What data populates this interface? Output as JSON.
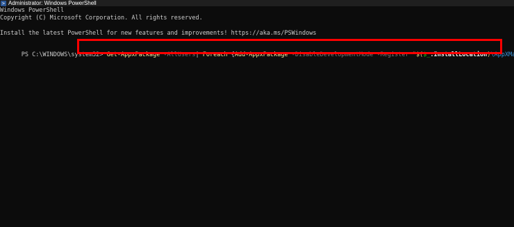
{
  "window": {
    "title": "Administrator: Windows PowerShell",
    "icon": "powershell-icon"
  },
  "console": {
    "header_line_1": "Windows PowerShell",
    "header_line_2": "Copyright (C) Microsoft Corporation. All rights reserved.",
    "header_line_3": "Install the latest PowerShell for new features and improvements! https://aka.ms/PSWindows",
    "prompt": "PS C:\\WINDOWS\\system32> ",
    "command_tokens": [
      {
        "text": "Get-AppxPackage",
        "role": "cmdlet"
      },
      {
        "text": " -AllUsers",
        "role": "param"
      },
      {
        "text": "| ",
        "role": "operator"
      },
      {
        "text": "Foreach",
        "role": "cmdlet"
      },
      {
        "text": " {",
        "role": "operator"
      },
      {
        "text": "Add-AppxPackage",
        "role": "cmdlet"
      },
      {
        "text": " -DisableDevelopmentMode",
        "role": "param"
      },
      {
        "text": " -Register",
        "role": "param"
      },
      {
        "text": " \"$(",
        "role": "string"
      },
      {
        "text": "$_",
        "role": "variable"
      },
      {
        "text": ".InstallLocation",
        "role": "member"
      },
      {
        "text": ")",
        "role": "string"
      },
      {
        "text": "\\AppXManifest.xml",
        "role": "path"
      },
      {
        "text": "\"",
        "role": "string"
      },
      {
        "text": "}",
        "role": "operator"
      }
    ]
  },
  "colors": {
    "background": "#0c0c0c",
    "text": "#cccccc",
    "cmdlet": "#f9f1a5",
    "param": "#7a7a7a",
    "variable": "#16c60c",
    "path": "#3a96dd",
    "highlight": "#ff0000"
  }
}
